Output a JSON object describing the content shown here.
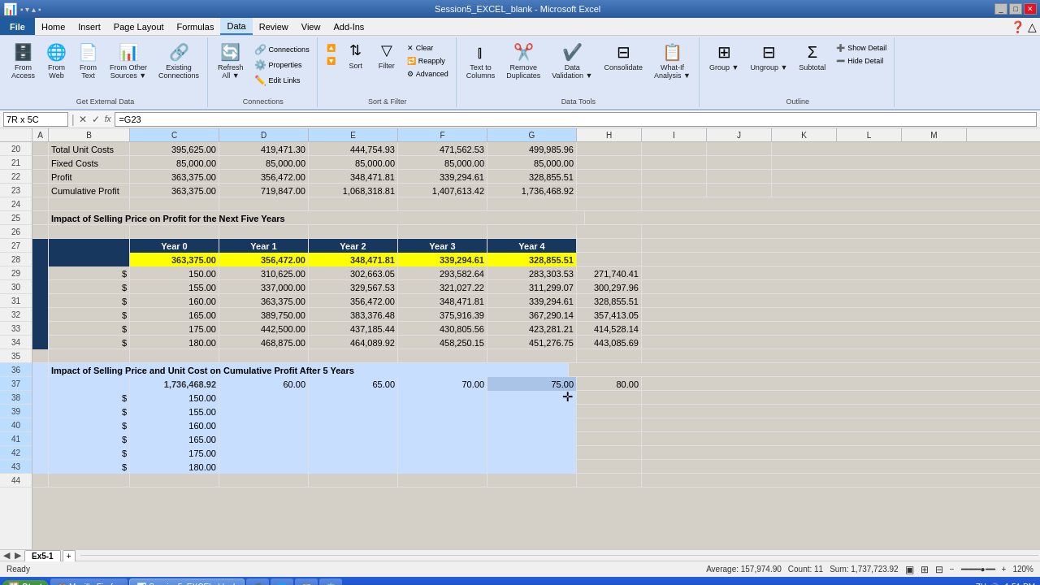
{
  "window": {
    "title": "Session5_EXCEL_blank - Microsoft Excel"
  },
  "menu": {
    "items": [
      "File",
      "Home",
      "Insert",
      "Page Layout",
      "Formulas",
      "Data",
      "Review",
      "View",
      "Add-Ins"
    ]
  },
  "ribbon": {
    "active_tab": "Data",
    "groups": [
      {
        "label": "Get External Data",
        "buttons": [
          {
            "id": "from-access",
            "icon": "🗄️",
            "label": "From\nAccess"
          },
          {
            "id": "from-web",
            "icon": "🌐",
            "label": "From\nWeb"
          },
          {
            "id": "from-text",
            "icon": "📄",
            "label": "From\nText"
          },
          {
            "id": "from-other-sources",
            "icon": "📊",
            "label": "From Other\nSources"
          },
          {
            "id": "existing-connections",
            "icon": "🔗",
            "label": "Existing\nConnections"
          }
        ]
      },
      {
        "label": "Connections",
        "small_buttons": [
          {
            "id": "connections",
            "icon": "🔗",
            "label": "Connections"
          },
          {
            "id": "properties",
            "icon": "⚙️",
            "label": "Properties"
          },
          {
            "id": "edit-links",
            "icon": "✏️",
            "label": "Edit Links"
          }
        ],
        "buttons": [
          {
            "id": "refresh-all",
            "icon": "🔄",
            "label": "Refresh\nAll ▼"
          }
        ]
      },
      {
        "label": "Sort & Filter",
        "buttons": [
          {
            "id": "sort-asc",
            "icon": "↑",
            "label": ""
          },
          {
            "id": "sort-desc",
            "icon": "↓",
            "label": ""
          },
          {
            "id": "sort",
            "icon": "⇅",
            "label": "Sort"
          },
          {
            "id": "filter",
            "icon": "▽",
            "label": "Filter"
          },
          {
            "id": "clear",
            "icon": "✕",
            "label": "Clear"
          },
          {
            "id": "reapply",
            "icon": "🔁",
            "label": "Reapply"
          },
          {
            "id": "advanced",
            "icon": "⚙",
            "label": "Advanced"
          }
        ]
      },
      {
        "label": "Data Tools",
        "buttons": [
          {
            "id": "text-to-columns",
            "icon": "⫿",
            "label": "Text to\nColumns"
          },
          {
            "id": "remove-duplicates",
            "icon": "✂️",
            "label": "Remove\nDuplicates"
          },
          {
            "id": "data-validation",
            "icon": "✔️",
            "label": "Data\nValidation ▼"
          },
          {
            "id": "consolidate",
            "icon": "⊟",
            "label": "Consolidate"
          },
          {
            "id": "what-if",
            "icon": "📋",
            "label": "What-If\nAnalysis ▼"
          }
        ]
      },
      {
        "label": "Outline",
        "buttons": [
          {
            "id": "group",
            "icon": "⊞",
            "label": "Group ▼"
          },
          {
            "id": "ungroup",
            "icon": "⊟",
            "label": "Ungroup ▼"
          },
          {
            "id": "subtotal",
            "icon": "Σ",
            "label": "Subtotal"
          }
        ],
        "small_buttons": [
          {
            "id": "show-detail",
            "icon": "➕",
            "label": "Show Detail"
          },
          {
            "id": "hide-detail",
            "icon": "➖",
            "label": "Hide Detail"
          }
        ]
      }
    ]
  },
  "formula_bar": {
    "name_box": "7R x 5C",
    "formula": "=G23"
  },
  "columns": {
    "headers": [
      "",
      "A",
      "B",
      "C",
      "D",
      "E",
      "F",
      "G",
      "H",
      "I",
      "J",
      "K",
      "L",
      "M"
    ]
  },
  "rows": [
    {
      "num": 20,
      "cells": {
        "B": "Total Unit Costs",
        "C": "395,625.00",
        "D": "419,471.30",
        "E": "444,754.93",
        "F": "471,562.53",
        "G": "499,985.96"
      }
    },
    {
      "num": 21,
      "cells": {
        "B": "Fixed Costs",
        "C": "85,000.00",
        "D": "85,000.00",
        "E": "85,000.00",
        "F": "85,000.00",
        "G": "85,000.00"
      }
    },
    {
      "num": 22,
      "cells": {
        "B": "Profit",
        "C": "363,375.00",
        "D": "356,472.00",
        "E": "348,471.81",
        "F": "339,294.61",
        "G": "328,855.51"
      }
    },
    {
      "num": 23,
      "cells": {
        "B": "Cumulative Profit",
        "C": "363,375.00",
        "D": "719,847.00",
        "E": "1,068,318.81",
        "F": "1,407,613.42",
        "G": "1,736,468.92"
      }
    },
    {
      "num": 24,
      "cells": {}
    },
    {
      "num": 25,
      "cells": {
        "B": "Impact of Selling Price on Profit for the Next Five Years"
      }
    },
    {
      "num": 26,
      "cells": {}
    },
    {
      "num": 27,
      "cells": {
        "C": "Year 0",
        "D": "Year 1",
        "E": "Year 2",
        "F": "Year 3",
        "G": "Year 4"
      },
      "style": "header"
    },
    {
      "num": 28,
      "cells": {
        "C": "363,375.00",
        "D": "356,472.00",
        "E": "348,471.81",
        "F": "339,294.61",
        "G": "328,855.51"
      },
      "style": "yellow"
    },
    {
      "num": 29,
      "cells": {
        "B": "$",
        "C": "150.00",
        "D": "310,625.00",
        "E": "302,663.05",
        "F": "293,582.64",
        "G": "283,303.53",
        "H_val": "271,740.41"
      }
    },
    {
      "num": 30,
      "cells": {
        "B": "$",
        "C": "155.00",
        "D": "337,000.00",
        "E": "329,567.53",
        "F": "321,027.22",
        "G": "311,299.07",
        "H_val": "300,297.96"
      }
    },
    {
      "num": 31,
      "cells": {
        "B": "$",
        "C": "160.00",
        "D": "363,375.00",
        "E": "356,472.00",
        "F": "348,471.81",
        "G": "339,294.61",
        "H_val": "328,855.51"
      }
    },
    {
      "num": 32,
      "cells": {
        "B": "$",
        "C": "165.00",
        "D": "389,750.00",
        "E": "383,376.48",
        "F": "375,916.39",
        "G": "367,290.14",
        "H_val": "357,413.05"
      }
    },
    {
      "num": 33,
      "cells": {
        "B": "$",
        "C": "175.00",
        "D": "442,500.00",
        "E": "437,185.44",
        "F": "430,805.56",
        "G": "423,281.21",
        "H_val": "414,528.14"
      }
    },
    {
      "num": 34,
      "cells": {
        "B": "$",
        "C": "180.00",
        "D": "468,875.00",
        "E": "464,089.92",
        "F": "458,250.15",
        "G": "451,276.75",
        "H_val": "443,085.69"
      }
    },
    {
      "num": 35,
      "cells": {}
    },
    {
      "num": 36,
      "cells": {
        "B": "Impact of Selling Price and Unit Cost on Cumulative Profit After 5 Years"
      }
    },
    {
      "num": 37,
      "cells": {
        "C": "1,736,468.92",
        "D": "60.00",
        "E": "65.00",
        "F": "70.00",
        "G": "75.00",
        "H_val": "80.00"
      },
      "style": "selected-header"
    },
    {
      "num": 38,
      "cells": {
        "B": "$",
        "C": "150.00"
      },
      "style": "selected"
    },
    {
      "num": 39,
      "cells": {
        "B": "$",
        "C": "155.00"
      },
      "style": "selected"
    },
    {
      "num": 40,
      "cells": {
        "B": "$",
        "C": "160.00"
      },
      "style": "selected"
    },
    {
      "num": 41,
      "cells": {
        "B": "$",
        "C": "165.00"
      },
      "style": "selected"
    },
    {
      "num": 42,
      "cells": {
        "B": "$",
        "C": "175.00"
      },
      "style": "selected"
    },
    {
      "num": 43,
      "cells": {
        "B": "$",
        "C": "180.00"
      },
      "style": "selected"
    },
    {
      "num": 44,
      "cells": {}
    }
  ],
  "sheet_tabs": [
    "Ex5-1"
  ],
  "status_bar": {
    "ready": "Ready",
    "average": "Average: 157,974.90",
    "count": "Count: 11",
    "sum": "Sum: 1,737,723.92",
    "zoom": "120%"
  },
  "taskbar": {
    "time": "1:51 PM",
    "apps": [
      "🪟",
      "🦊",
      "🎵",
      "🌐",
      "📁",
      "📊",
      "⚙️",
      "🎯"
    ]
  }
}
